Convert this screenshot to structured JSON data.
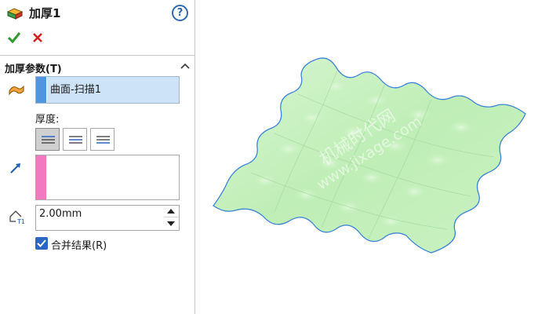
{
  "panel": {
    "title": "加厚1",
    "help_symbol": "?",
    "icons": {
      "feature": "thicken-feature-icon",
      "ok": "checkmark-icon",
      "cancel": "close-icon",
      "help": "help-icon",
      "collapse": "chevron-up-icon",
      "face": "surface-selection-icon",
      "vector": "direction-arrow-icon",
      "thickness": "thickness-dimension-icon"
    },
    "section": {
      "title": "加厚参数(T)",
      "selected_face": "曲面-扫描1",
      "thickness_label": "厚度:",
      "direction_buttons": [
        "thicken-side-1",
        "thicken-both-sides",
        "thicken-side-2"
      ],
      "thickness_value": "2.00mm",
      "merge_label": "合并结果(R)",
      "merge_checked": true
    },
    "colors": {
      "face_selection": "#4f95df",
      "vector_selection": "#f07ac0",
      "ok_green": "#2e9a2e",
      "cancel_red": "#d42020"
    }
  },
  "viewport": {
    "watermark_line1": "机械时代网",
    "watermark_line2": "www.jixage.com",
    "model_color": "#c8f0c0"
  }
}
